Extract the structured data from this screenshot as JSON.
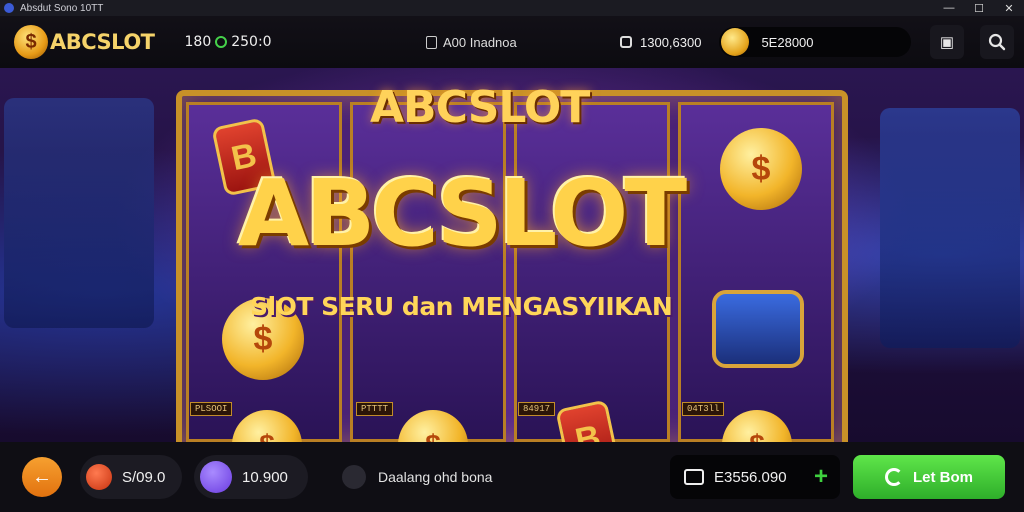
{
  "window": {
    "title": "Absdut Sono 10TT",
    "controls": [
      "minimize",
      "maximize",
      "close"
    ]
  },
  "header": {
    "logo_text": "ABCSLOT",
    "balance_text": "180",
    "balance_suffix": "250:0",
    "nav_item_label": "A00 Inadnoa",
    "timer_text": "1300,6300",
    "coin_balance": "5E28000",
    "icons": [
      "logo-coin-icon",
      "status-ring-icon",
      "document-icon",
      "lock-icon",
      "gold-coin-icon",
      "calendar-icon",
      "search-icon"
    ]
  },
  "banner": {
    "small_logo": "ABCSLOT",
    "big_logo": "ABCSLOT",
    "tagline": "SlOT SERU dan MENGASYIIKAN",
    "reel_labels": [
      "PLSOOI",
      "PTTTT",
      "84917",
      "04T3ll"
    ],
    "chip_symbol": "B",
    "coin_symbol": "$"
  },
  "bottom": {
    "back_icon": "back-arrow-icon",
    "bet_value": "S/09.0",
    "spins_value": "10.900",
    "status_text": "Daalang ohd bona",
    "wallet_value": "E3556.090",
    "wallet_plus": "+",
    "cta_label": "Let Bom"
  },
  "colors": {
    "accent_gold": "#ffd24a",
    "cta_green": "#3fc935",
    "back_orange": "#f28a1a",
    "spins_purple": "#7a4cf0"
  }
}
